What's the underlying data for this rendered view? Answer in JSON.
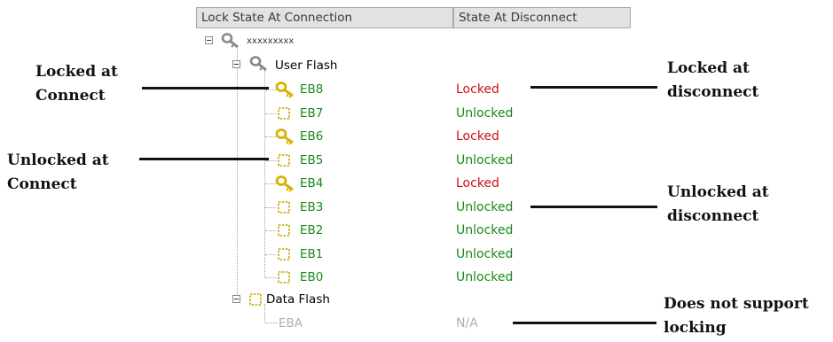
{
  "header": {
    "col1": "Lock State At Connection",
    "col2": "State At Disconnect"
  },
  "tree": {
    "root": "xxxxxxxxx",
    "user_flash": "User Flash",
    "data_flash": "Data Flash",
    "blocks": [
      {
        "name": "EB8",
        "icon": "key-icon",
        "state": "Locked"
      },
      {
        "name": "EB7",
        "icon": "dashed-box-icon",
        "state": "Unlocked"
      },
      {
        "name": "EB6",
        "icon": "key-icon",
        "state": "Locked"
      },
      {
        "name": "EB5",
        "icon": "dashed-box-icon",
        "state": "Unlocked"
      },
      {
        "name": "EB4",
        "icon": "key-icon",
        "state": "Locked"
      },
      {
        "name": "EB3",
        "icon": "dashed-box-icon",
        "state": "Unlocked"
      },
      {
        "name": "EB2",
        "icon": "dashed-box-icon",
        "state": "Unlocked"
      },
      {
        "name": "EB1",
        "icon": "dashed-box-icon",
        "state": "Unlocked"
      },
      {
        "name": "EB0",
        "icon": "dashed-box-icon",
        "state": "Unlocked"
      }
    ],
    "data_block": {
      "name": "EBA",
      "state": "N/A"
    }
  },
  "annotations": {
    "locked_at_connect": [
      "Locked at",
      "Connect"
    ],
    "unlocked_at_connect": [
      "Unlocked at",
      "Connect"
    ],
    "locked_at_disconnect": [
      "Locked at",
      "disconnect"
    ],
    "unlocked_at_disconnect": [
      "Unlocked at",
      "disconnect"
    ],
    "not_supported": [
      "Does not support",
      "locking"
    ]
  },
  "colors": {
    "locked": "#cc1111",
    "unlocked": "#1a8a1a",
    "node": "#1a1a9a",
    "na": "#b0b0b0",
    "key": "#d8b400"
  }
}
